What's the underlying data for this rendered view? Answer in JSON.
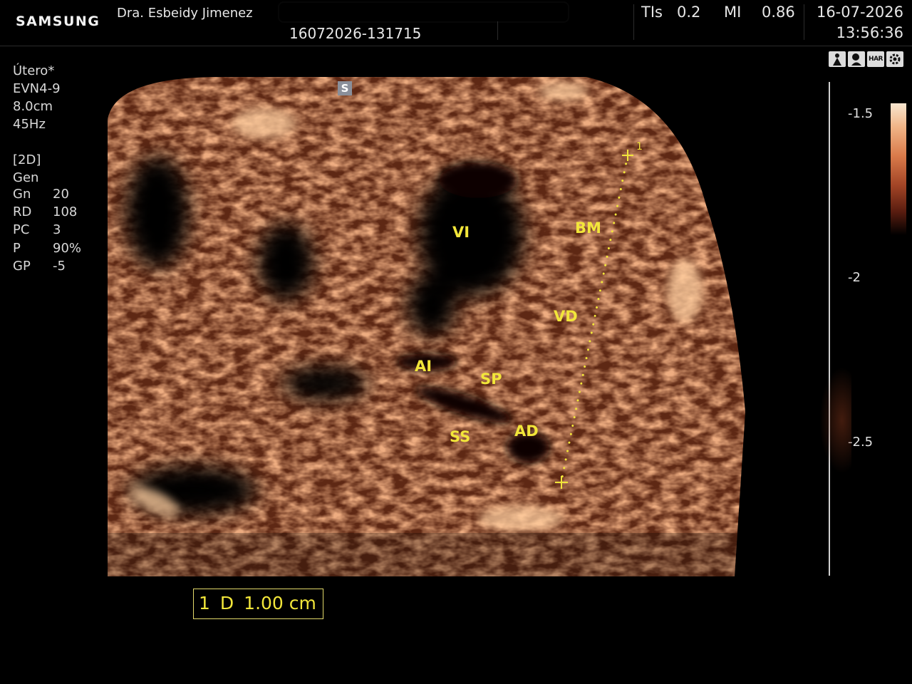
{
  "header": {
    "brand": "SAMSUNG",
    "doctor_name": "Dra. Esbeidy Jimenez",
    "patient_id": "16072026-131715",
    "tis_label": "TIs",
    "tis_value": "0.2",
    "mi_label": "MI",
    "mi_value": "0.86",
    "date": "16-07-2026",
    "time": "13:56:36"
  },
  "preset": {
    "exam": "Útero*",
    "probe": "EVN4-9",
    "depth": "8.0cm",
    "frame_rate": "45Hz"
  },
  "mode": {
    "name": "[2D]",
    "setting": "Gen",
    "params": [
      {
        "name": "Gn",
        "value": "20"
      },
      {
        "name": "RD",
        "value": "108"
      },
      {
        "name": "PC",
        "value": "3"
      },
      {
        "name": "P",
        "value": "90%"
      },
      {
        "name": "GP",
        "value": "-5"
      }
    ]
  },
  "toolbar": {
    "icons": [
      "fetal-icon",
      "fetal-heart-icon",
      "har-icon",
      "settings-icon"
    ],
    "har_label": "HAR"
  },
  "depth_scale": {
    "ticks": [
      "-1.5",
      "-2",
      "-2.5"
    ]
  },
  "image": {
    "orientation_marker": "S",
    "annotations": [
      "VI",
      "BM",
      "VD",
      "AI",
      "SP",
      "SS",
      "AD"
    ],
    "caliper_index": "1"
  },
  "measurement": {
    "index": "1",
    "type": "D",
    "value": "1.00 cm"
  },
  "colors": {
    "annotation": "#f2e63a",
    "background": "#000000",
    "tissue": "#c0623a"
  }
}
